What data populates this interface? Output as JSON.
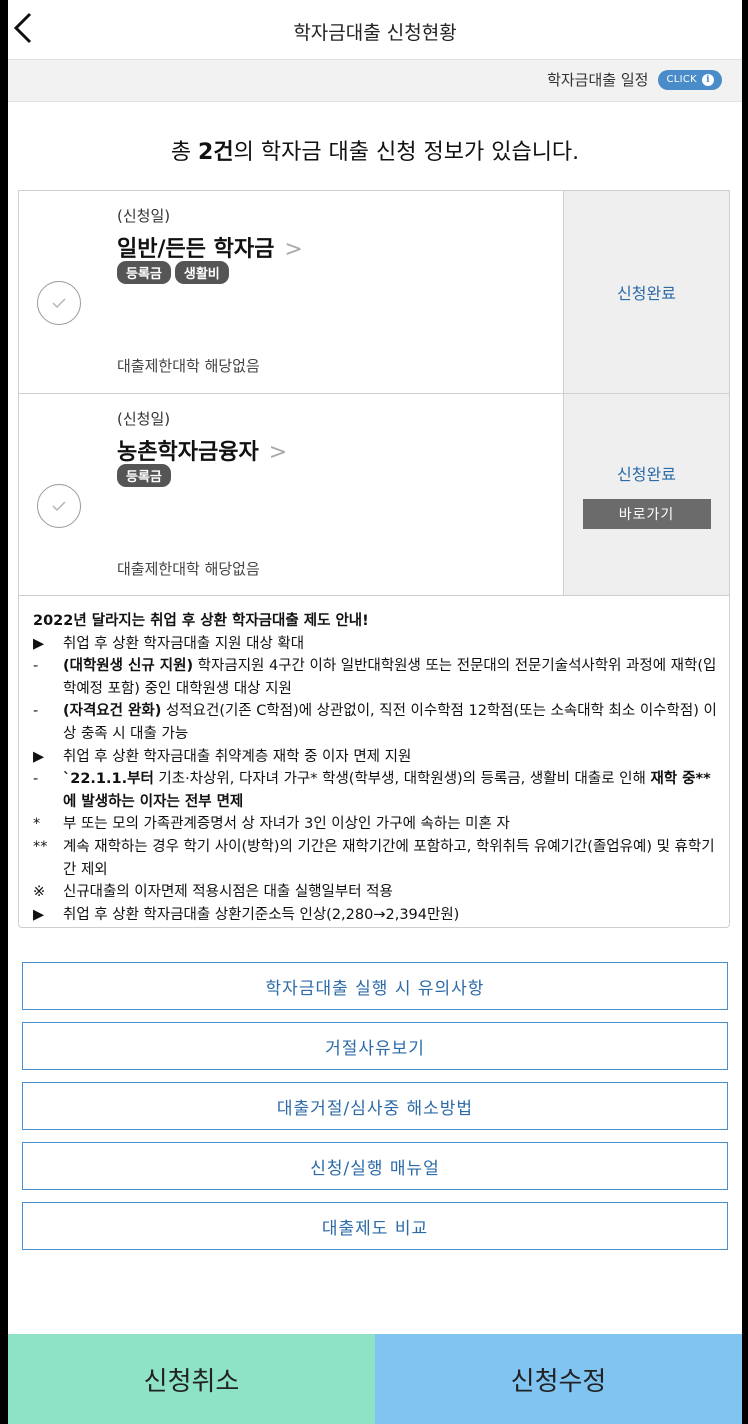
{
  "header": {
    "title": "학자금대출 신청현황"
  },
  "schedule": {
    "label": "학자금대출 일정",
    "badge": "CLICK"
  },
  "summary": {
    "prefix": "총 ",
    "count": "2건",
    "suffix": "의 학자금 대출 신청 정보가 있습니다."
  },
  "loans": [
    {
      "date_label": "(신청일)",
      "name": "일반/든든 학자금",
      "tags": [
        "등록금",
        "생활비"
      ],
      "restriction": "대출제한대학 해당없음",
      "status": "신청완료"
    },
    {
      "date_label": "(신청일)",
      "name": "농촌학자금융자",
      "tags": [
        "등록금"
      ],
      "restriction": "대출제한대학 해당없음",
      "status": "신청완료",
      "action": "바로가기"
    }
  ],
  "notice": {
    "title": "2022년 달라지는 취업 후 상환 학자금대출 제도 안내!",
    "lines": [
      {
        "mark": "▶",
        "pre": "취업 후 상환 학자금대출 지원 대상 확대",
        "bold": "",
        "post": ""
      },
      {
        "mark": "-",
        "pre": "",
        "bold": "(대학원생 신규 지원)",
        "post": " 학자금지원 4구간 이하 일반대학원생 또는 전문대의 전문기술석사학위 과정에 재학(입학예정 포함) 중인 대학원생 대상 지원"
      },
      {
        "mark": "-",
        "pre": "",
        "bold": "(자격요건 완화)",
        "post": " 성적요건(기존 C학점)에 상관없이, 직전 이수학점 12학점(또는 소속대학 최소 이수학점) 이상 충족 시 대출 가능"
      },
      {
        "mark": "▶",
        "pre": "취업 후 상환 학자금대출 취약계층 재학 중 이자 면제 지원",
        "bold": "",
        "post": ""
      },
      {
        "mark": "-",
        "pre": "",
        "bold": "`22.1.1.부터",
        "post": " 기초·차상위, 다자녀 가구* 학생(학부생, 대학원생)의 등록금, 생활비 대출로 인해 ",
        "bold2": "재학 중**에 발생하는 이자는 전부 면제"
      },
      {
        "mark": "*",
        "pre": "부 또는 모의 가족관계증명서 상 자녀가 3인 이상인 가구에 속하는 미혼 자",
        "bold": "",
        "post": ""
      },
      {
        "mark": "**",
        "pre": "계속 재학하는 경우 학기 사이(방학)의 기간은 재학기간에 포함하고, 학위취득 유예기간(졸업유예) 및 휴학기간 제외",
        "bold": "",
        "post": ""
      },
      {
        "mark": "※",
        "pre": "신규대출의 이자면제 적용시점은 대출 실행일부터 적용",
        "bold": "",
        "post": ""
      },
      {
        "mark": "▶",
        "pre": "취업 후 상환 학자금대출 상환기준소득 인상(2,280→2,394만원)",
        "bold": "",
        "post": ""
      }
    ]
  },
  "buttons": [
    "학자금대출 실행 시 유의사항",
    "거절사유보기",
    "대출거절/심사중 해소방법",
    "신청/실행 매뉴얼",
    "대출제도 비교"
  ],
  "bottom": {
    "cancel": "신청취소",
    "modify": "신청수정"
  },
  "colors": {
    "accent": "#2c6aa8",
    "cancel_bg": "#8ee2c6",
    "modify_bg": "#80c4f2",
    "badge": "#4a8cc9"
  }
}
